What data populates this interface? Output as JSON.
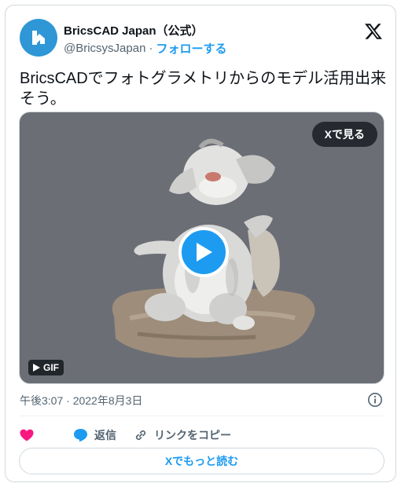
{
  "author": {
    "display_name": "BricsCAD Japan（公式）",
    "handle": "@BricsysJapan",
    "separator": "·",
    "follow_label": "フォローする",
    "avatar_color": "#2f97d6"
  },
  "tweet": {
    "text": "BricsCADでフォトグラメトリからのモデル活用出来そう。",
    "timestamp": "午後3:07 · 2022年8月3日"
  },
  "media": {
    "view_on_x_label": "Xで見る",
    "gif_label": "GIF",
    "background_color": "#6b6e75"
  },
  "actions": {
    "reply_label": "返信",
    "copy_link_label": "リンクをコピー",
    "read_more_label": "Xでもっと読む"
  },
  "colors": {
    "accent": "#1d9bf0",
    "like": "#f91880",
    "muted": "#536471"
  }
}
